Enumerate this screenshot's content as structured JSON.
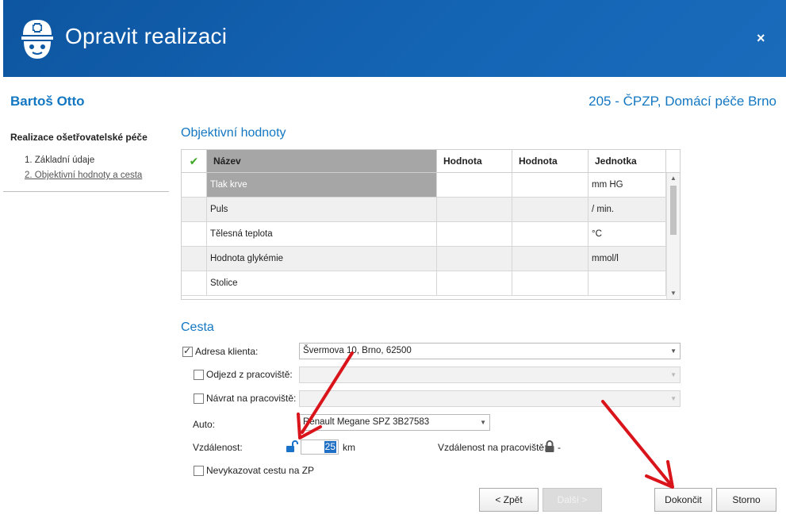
{
  "window": {
    "title": "Opravit realizaci",
    "close_label": "×",
    "logo_icon": "nurse-icon"
  },
  "patient": {
    "name": "Bartoš Otto",
    "insurer": "205 - ČPZP, Domácí péče Brno"
  },
  "nav": {
    "title": "Realizace ošetřovatelské péče",
    "items": [
      {
        "label": "1. Základní údaje",
        "active": false
      },
      {
        "label": "2. Objektivní hodnoty a cesta",
        "active": true
      }
    ]
  },
  "objective": {
    "title": "Objektivní hodnoty",
    "columns": [
      "Název",
      "Hodnota",
      "Hodnota",
      "Jednotka"
    ],
    "rows": [
      {
        "name": "Tlak krve",
        "v1": "",
        "v2": "",
        "unit": "mm HG"
      },
      {
        "name": "Puls",
        "v1": "",
        "v2": "",
        "unit": "/ min."
      },
      {
        "name": "Tělesná teplota",
        "v1": "",
        "v2": "",
        "unit": "°C"
      },
      {
        "name": "Hodnota glykémie",
        "v1": "",
        "v2": "",
        "unit": "mmol/l"
      },
      {
        "name": "Stolice",
        "v1": "",
        "v2": "",
        "unit": ""
      }
    ]
  },
  "trip": {
    "title": "Cesta",
    "client_address_label": "Adresa klienta:",
    "client_address_value": "Švermova 10, Brno, 62500",
    "client_address_checked": true,
    "departure_label": "Odjezd z pracoviště:",
    "departure_value": "",
    "return_label": "Návrat na pracoviště:",
    "return_value": "",
    "car_label": "Auto:",
    "car_value": "Renault Megane SPZ 3B27583",
    "distance_label": "Vzdálenost:",
    "distance_value": "25",
    "distance_unit": "km",
    "workplace_distance_label": "Vzdálenost na pracoviště:",
    "workplace_distance_value": "-",
    "no_report_label": "Nevykazovat cestu na ZP"
  },
  "buttons": {
    "back": "< Zpět",
    "next": "Další >",
    "finish": "Dokončit",
    "cancel": "Storno"
  },
  "colors": {
    "header": "#0f5aa5",
    "accent": "#1477c2",
    "annotation_arrow": "#d9141b"
  }
}
